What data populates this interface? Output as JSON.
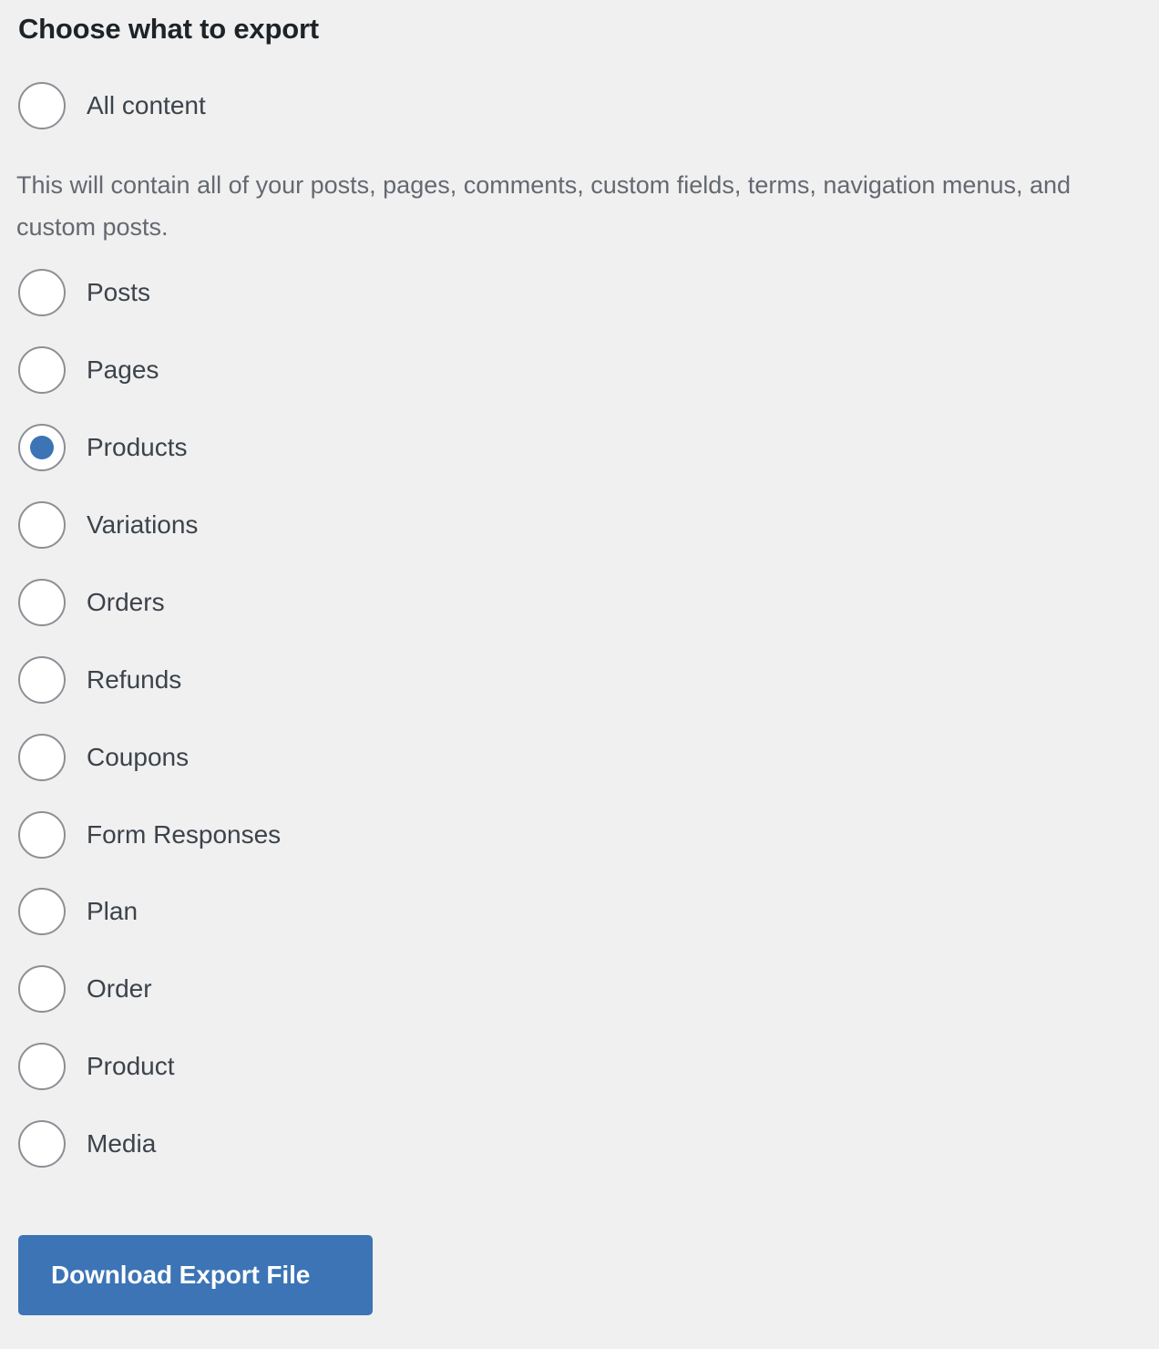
{
  "panel": {
    "heading": "Choose what to export",
    "all_content_description": "This will contain all of your posts, pages, comments, custom fields, terms, navigation menus, and custom posts."
  },
  "options": [
    {
      "label": "All content",
      "checked": false
    },
    {
      "label": "Posts",
      "checked": false
    },
    {
      "label": "Pages",
      "checked": false
    },
    {
      "label": "Products",
      "checked": true
    },
    {
      "label": "Variations",
      "checked": false
    },
    {
      "label": "Orders",
      "checked": false
    },
    {
      "label": "Refunds",
      "checked": false
    },
    {
      "label": "Coupons",
      "checked": false
    },
    {
      "label": "Form Responses",
      "checked": false
    },
    {
      "label": "Plan",
      "checked": false
    },
    {
      "label": "Order",
      "checked": false
    },
    {
      "label": "Product",
      "checked": false
    },
    {
      "label": "Media",
      "checked": false
    }
  ],
  "actions": {
    "download_label": "Download Export File"
  },
  "colors": {
    "background": "#f0f0f1",
    "accent": "#3c74b5",
    "heading_text": "#1d2327",
    "label_text": "#3c434a",
    "description_text": "#646970",
    "radio_border": "#8c8f94"
  },
  "layout": {
    "option_tops": [
      88,
      293,
      378,
      463,
      548,
      633,
      718,
      803,
      888,
      972,
      1057,
      1142,
      1227
    ]
  }
}
